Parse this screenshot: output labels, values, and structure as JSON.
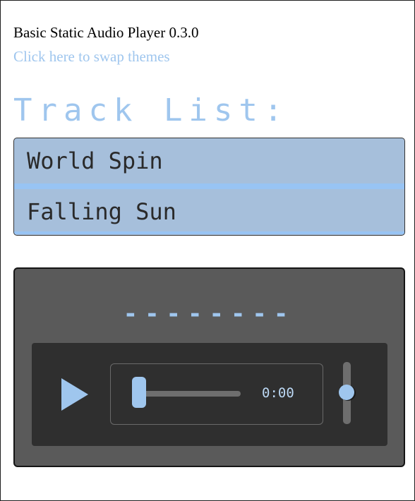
{
  "app": {
    "title": "Basic Static Audio Player 0.3.0",
    "theme_link": "Click here to swap themes"
  },
  "tracklist": {
    "heading": "Track List:",
    "tracks": [
      {
        "label": "World Spin"
      },
      {
        "label": "Falling Sun"
      }
    ]
  },
  "player": {
    "now_playing": "--------",
    "time": "0:00",
    "seek_progress": 0,
    "volume_level": 0.5,
    "play_icon": "play-icon"
  },
  "colors": {
    "accent": "#9fc6ee",
    "tracklist_bg": "#a6bfdb",
    "player_bg": "#5a5a5a",
    "controls_bg": "#2f2f2f"
  }
}
